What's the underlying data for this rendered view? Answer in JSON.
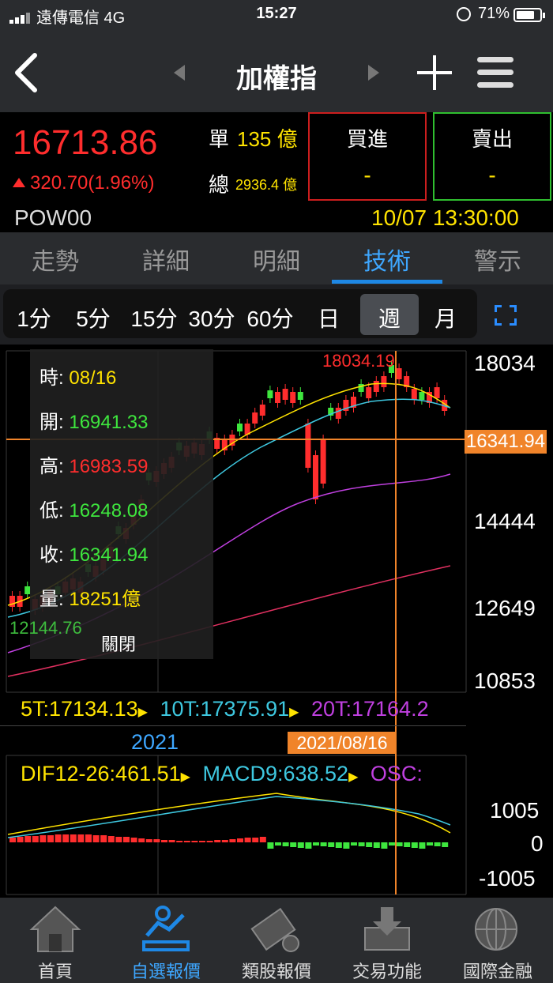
{
  "status": {
    "carrier": "遠傳電信  4G",
    "time": "15:27",
    "battery": "71%"
  },
  "header": {
    "title": "加權指"
  },
  "quote": {
    "price": "16713.86",
    "change": "320.70(1.96%)",
    "single_label": "單",
    "single_value": "135 億",
    "total_label": "總",
    "total_value": "2936.4 億",
    "buy_label": "買進",
    "buy_value": "-",
    "sell_label": "賣出",
    "sell_value": "-",
    "code": "POW00",
    "datetime": "10/07 13:30:00"
  },
  "tabs": [
    {
      "label": "走勢"
    },
    {
      "label": "詳細"
    },
    {
      "label": "明細"
    },
    {
      "label": "技術"
    },
    {
      "label": "警示"
    }
  ],
  "periods": [
    "1分",
    "5分",
    "15分",
    "30分",
    "60分",
    "日",
    "週",
    "月"
  ],
  "chart": {
    "y_labels": [
      "18034",
      "14444",
      "12649",
      "10853"
    ],
    "current_price_tag": "16341.94",
    "high_label": "18034.19",
    "low_label": "12144.76",
    "ma_5": "5T:17134.13",
    "ma_10": "10T:17375.91",
    "ma_20": "20T:17164.2",
    "year_label": "2021",
    "cursor_date": "2021/08/16",
    "macd_dif": "DIF12-26:461.51",
    "macd_9": "MACD9:638.52",
    "macd_osc": "OSC:",
    "macd_y_labels": [
      "1005",
      "0",
      "-1005"
    ],
    "colors": {
      "up": "#ff2d2d",
      "down": "#3ee63e",
      "ma5": "#ffe300",
      "ma10": "#3ec8e0",
      "ma20": "#c040e0",
      "cursor": "#f0842a"
    }
  },
  "info": {
    "time_label": "時:",
    "time_value": "08/16",
    "open_label": "開:",
    "open_value": "16941.33",
    "high_label": "高:",
    "high_value": "16983.59",
    "low_label": "低:",
    "low_value": "16248.08",
    "close_label": "收:",
    "close_value": "16341.94",
    "vol_label": "量:",
    "vol_value": "18251億",
    "close_button": "關閉"
  },
  "bottom_nav": [
    {
      "label": "首頁",
      "icon": "home-icon"
    },
    {
      "label": "自選報價",
      "icon": "favorite-quote-icon"
    },
    {
      "label": "類股報價",
      "icon": "sector-quote-icon"
    },
    {
      "label": "交易功能",
      "icon": "trade-icon"
    },
    {
      "label": "國際金融",
      "icon": "globe-icon"
    }
  ]
}
